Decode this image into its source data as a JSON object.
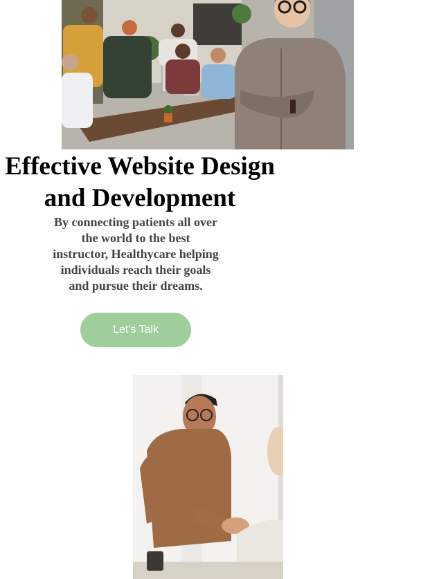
{
  "hero": {
    "image_icon": "office-team-photo",
    "headline": "Effective Website Design and Development",
    "intro": "By connecting patients all over the world to the best instructor, Healthycare helping individuals reach their goals and pursue their dreams.",
    "cta_label": "Let's Talk"
  },
  "second_section": {
    "image_icon": "handshake-photo"
  },
  "colors": {
    "button_bg": "#9fcd9c",
    "button_text": "#ffffff",
    "heading": "#000000",
    "body_text": "#444444"
  }
}
